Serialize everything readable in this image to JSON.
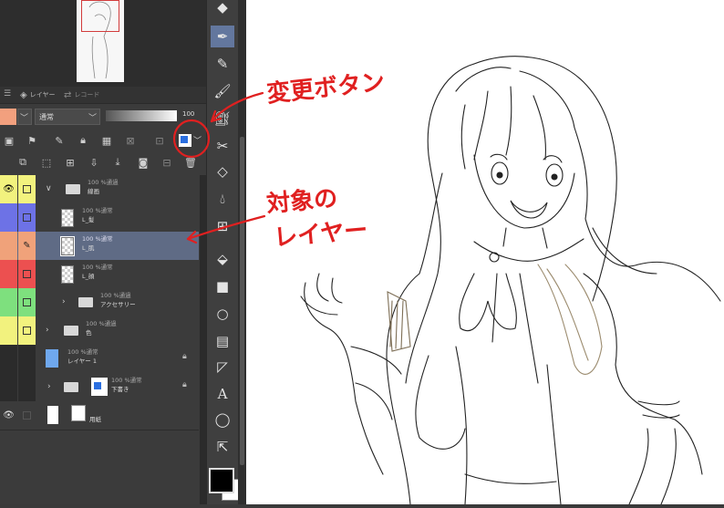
{
  "layer_panel": {
    "tabs": [
      {
        "label": "レイヤー"
      },
      {
        "label": "レコード"
      }
    ],
    "blend_mode": "通常",
    "opacity_value": "100"
  },
  "layers": [
    {
      "meta": "100 %通過",
      "name": "線画",
      "type": "folder",
      "eye_color": "#f2f27e",
      "lock_color": "#f2f27e",
      "expanded": true
    },
    {
      "meta": "100 %通常",
      "name": "L_髪",
      "type": "raster",
      "eye_color": "#6d72e6",
      "lock_color": "#6d72e6"
    },
    {
      "meta": "100 %通常",
      "name": "L_肌",
      "type": "raster",
      "eye_color": "#f0a27a",
      "lock_color": "#f0a27a",
      "selected": true
    },
    {
      "meta": "100 %通常",
      "name": "L_顔",
      "type": "raster",
      "eye_color": "#ec5050",
      "lock_color": "#ec5050"
    },
    {
      "meta": "100 %通過",
      "name": "アクセサリー",
      "type": "folder",
      "eye_color": "#7ee07e",
      "lock_color": "#7ee07e"
    },
    {
      "meta": "100 %通過",
      "name": "色",
      "type": "folder",
      "eye_color": "#f2f27e",
      "lock_color": "#f2f27e"
    },
    {
      "meta": "100 %通常",
      "name": "レイヤー 1",
      "type": "raster",
      "eye_color": "#2b2b2b",
      "lock_color": "#2b2b2b"
    },
    {
      "meta": "100 %通常",
      "name": "下書き",
      "type": "folder",
      "eye_color": "#2b2b2b",
      "lock_color": "#2b2b2b"
    },
    {
      "meta": "",
      "name": "用紙",
      "type": "paper",
      "eye_color": "#3b3b3b",
      "lock_color": "#3b3b3b"
    }
  ],
  "annotations": {
    "change_button": "変更ボタン",
    "target_layer_line1": "対象の",
    "target_layer_line2": "レイヤー"
  },
  "colors": {
    "main_color": "#000000",
    "sub_color": "#ffffff",
    "annotation_red": "#e02020",
    "selected_layer": "#5f6b85",
    "active_tool": "#63779e"
  },
  "tools": [
    "selection-area-icon",
    "pen-icon",
    "pencil-icon",
    "brush-icon",
    "airbrush-icon",
    "decoration-icon",
    "eraser-icon",
    "blend-icon",
    "fill-icon",
    "gradient-icon",
    "figure-icon",
    "frame-icon",
    "ruler-icon",
    "text-icon",
    "balloon-icon",
    "correct-line-icon"
  ]
}
